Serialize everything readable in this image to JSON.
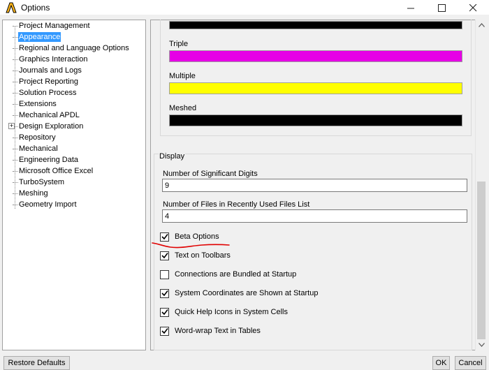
{
  "window": {
    "title": "Options",
    "logo_color": "#ffb71b"
  },
  "tree": {
    "items": [
      {
        "label": "Project Management",
        "selected": false
      },
      {
        "label": "Appearance",
        "selected": true
      },
      {
        "label": "Regional and Language Options",
        "selected": false
      },
      {
        "label": "Graphics Interaction",
        "selected": false
      },
      {
        "label": "Journals and Logs",
        "selected": false
      },
      {
        "label": "Project Reporting",
        "selected": false
      },
      {
        "label": "Solution Process",
        "selected": false
      },
      {
        "label": "Extensions",
        "selected": false
      },
      {
        "label": "Mechanical APDL",
        "selected": false
      },
      {
        "label": "Design Exploration",
        "selected": false,
        "expandable": true
      },
      {
        "label": "Repository",
        "selected": false
      },
      {
        "label": "Mechanical",
        "selected": false
      },
      {
        "label": "Engineering Data",
        "selected": false
      },
      {
        "label": "Microsoft Office Excel",
        "selected": false
      },
      {
        "label": "TurboSystem",
        "selected": false
      },
      {
        "label": "Meshing",
        "selected": false
      },
      {
        "label": "Geometry Import",
        "selected": false
      }
    ],
    "selection_color": "#3399ff"
  },
  "colors": {
    "items": [
      {
        "label": "",
        "color": "#000000"
      },
      {
        "label": "Triple",
        "color": "#e600e6"
      },
      {
        "label": "Multiple",
        "color": "#ffff00"
      },
      {
        "label": "Meshed",
        "color": "#000000"
      }
    ]
  },
  "display": {
    "legend": "Display",
    "significant_digits": {
      "label": "Number of Significant Digits",
      "value": "9"
    },
    "recent_files": {
      "label": "Number of Files in Recently Used Files List",
      "value": "4"
    },
    "checkboxes": [
      {
        "label": "Beta Options",
        "checked": true
      },
      {
        "label": "Text on Toolbars",
        "checked": true
      },
      {
        "label": "Connections are Bundled at Startup",
        "checked": false
      },
      {
        "label": "System Coordinates are Shown at Startup",
        "checked": true
      },
      {
        "label": "Quick Help Icons in System Cells",
        "checked": true
      },
      {
        "label": "Word-wrap Text in Tables",
        "checked": true
      }
    ]
  },
  "buttons": {
    "restore": "Restore Defaults",
    "ok": "OK",
    "cancel": "Cancel"
  },
  "annotation_color": "#e00000"
}
